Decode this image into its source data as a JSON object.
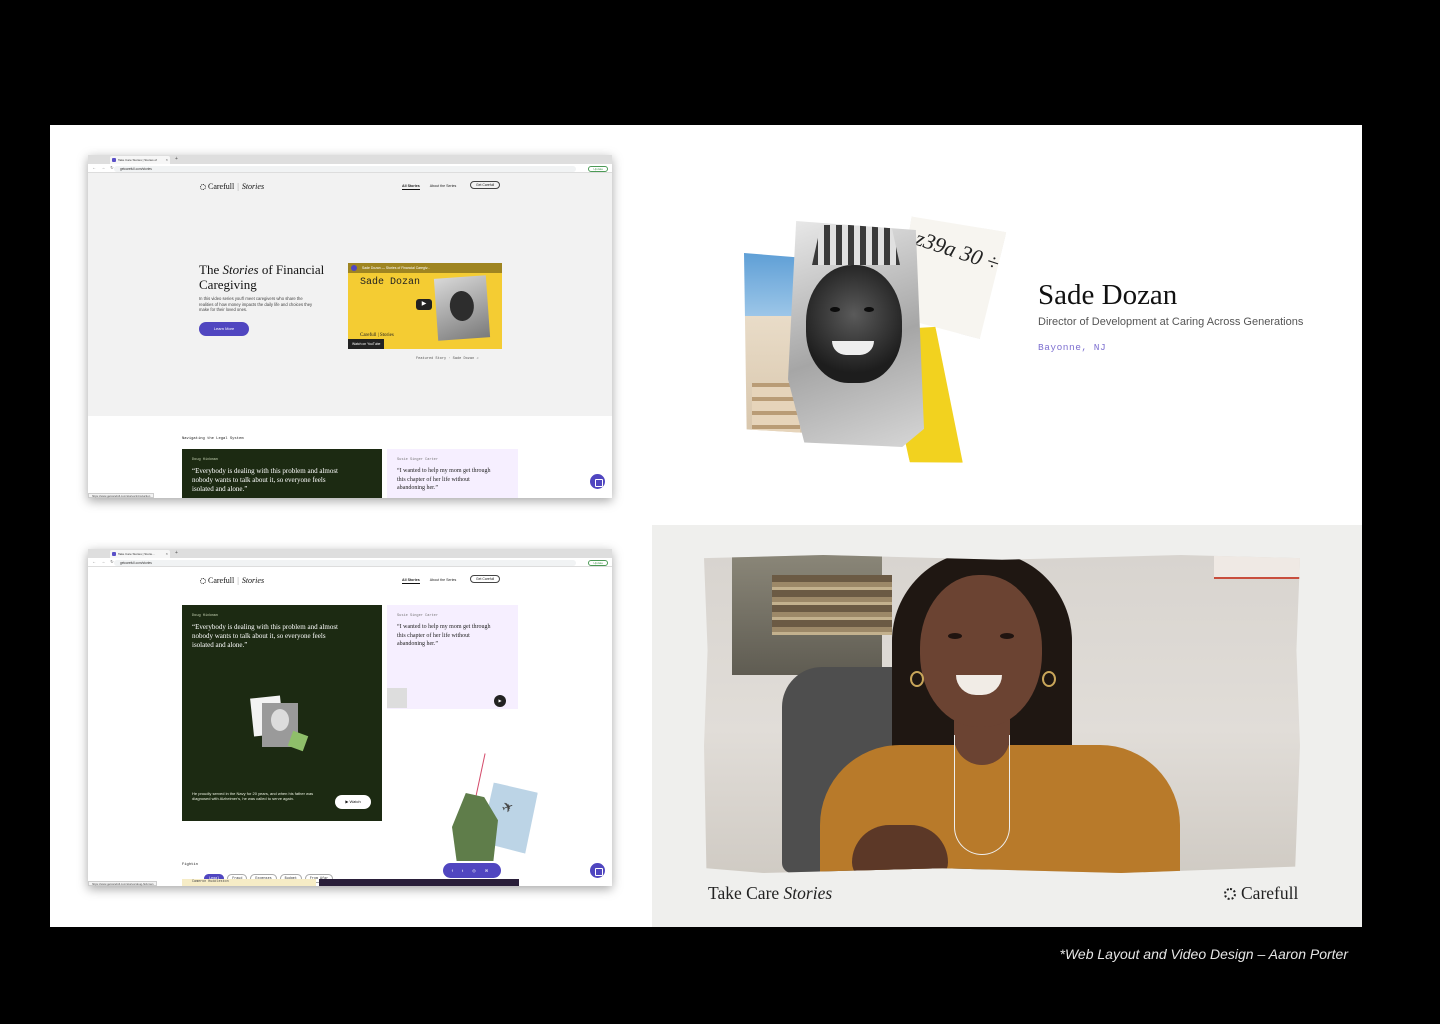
{
  "browser_top": {
    "tab_title": "Take Care Stories | Stories of",
    "url": "getcarefull.com/stories",
    "update_label": "Update",
    "logo_brand": "Carefull",
    "logo_sub": "Stories",
    "nav": [
      "All Stories",
      "About the Series"
    ],
    "cta": "Get Carefull",
    "hero_title_pre": "The ",
    "hero_title_em": "Stories",
    "hero_title_post": " of Financial Caregiving",
    "hero_desc": "In this video series you'll meet caregivers who share the realities of how money impacts the daily life and choices they make for their loved ones.",
    "learn_more": "Learn More",
    "video_header": "Sade Dozan — Stories of Financial Caregiv...",
    "video_name": "Sade Dozan",
    "video_logo": "Carefull | Stories",
    "watch_on": "Watch on YouTube",
    "featured": "Featured Story · Sade Dozan ↗",
    "section_label": "Navigating the Legal System",
    "card1_name": "Doug Hickman",
    "card1_quote": "“Everybody is dealing with this problem and almost nobody wants to talk about it, so everyone feels isolated and alone.”",
    "card2_name": "Susie Singer Carter",
    "card2_quote": "“I wanted to help my mom get through this chapter of her life without abandoning her.”",
    "status_url": "https://www.getcarefull.com/stories/introduction"
  },
  "browser_bottom": {
    "tab_title": "Take Care Stories | Storie...",
    "url": "getcarefull.com/stories",
    "update_label": "Update",
    "logo_brand": "Carefull",
    "logo_sub": "Stories",
    "nav": [
      "All Stories",
      "About the Series"
    ],
    "cta": "Get Carefull",
    "card1_name": "Doug Hickman",
    "card1_quote": "“Everybody is dealing with this problem and almost nobody wants to talk about it, so everyone feels isolated and alone.”",
    "card1_body": "He proudly served in the Navy for 20 years, and when his father was diagnosed with Alzheimer's, he was called to serve again.",
    "watch": "▶ Watch",
    "card2_name": "Susie Singer Carter",
    "card2_quote": "“I wanted to help my mom get through this chapter of her life without abandoning her.”",
    "section_label": "Fightin",
    "filters": [
      "Legal",
      "Fraud",
      "Expenses",
      "Budget",
      "From Afar"
    ],
    "share_icons": "f t ◎ ✉",
    "bottom_card_name": "Cameron Huddleston",
    "status_url": "https://www.getcarefull.com/stories/doug-hickman"
  },
  "profile": {
    "name": "Sade Dozan",
    "role": "Director of Development at Caring Across Generations",
    "location": "Bayonne, NJ",
    "scribble": "z39a 30 ÷"
  },
  "video": {
    "title_pre": "Take Care ",
    "title_em": "Stories",
    "brand": "Carefull"
  },
  "credit": "*Web Layout and Video Design – Aaron Porter",
  "colors": {
    "accent": "#5046c0",
    "card_green": "#1c2a12",
    "card_pink": "#f6efff",
    "location": "#7d6fd0",
    "yellow": "#f2d21f"
  }
}
